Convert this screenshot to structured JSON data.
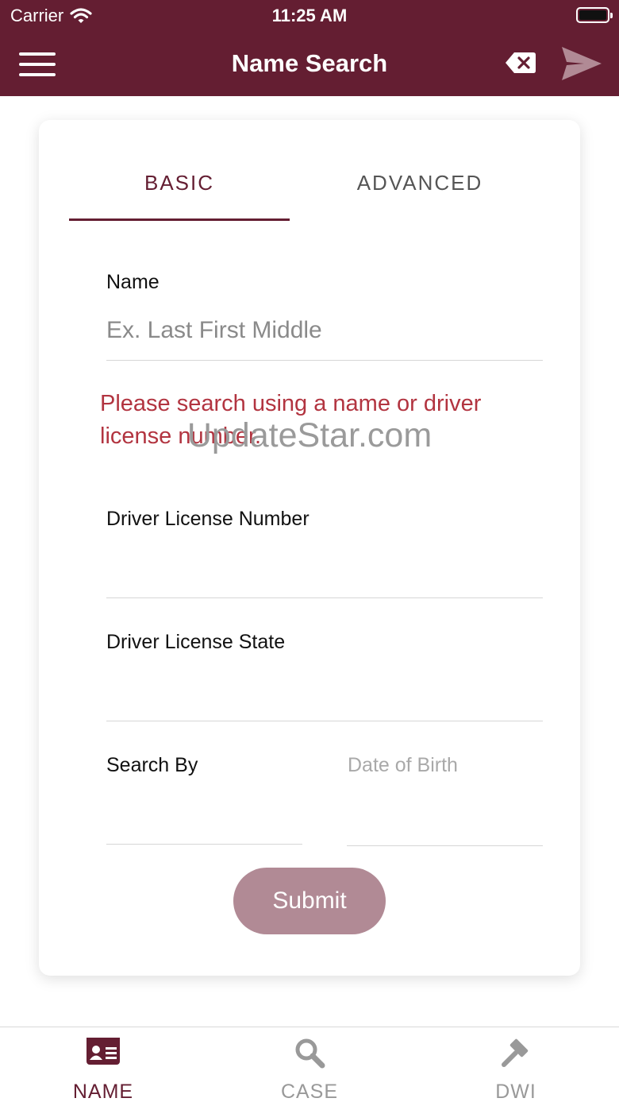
{
  "status_bar": {
    "carrier": "Carrier",
    "time": "11:25 AM"
  },
  "nav": {
    "title": "Name Search",
    "menu_icon": "hamburger-icon",
    "clear_icon": "backspace-icon",
    "send_icon": "send-icon"
  },
  "tabs": [
    {
      "label": "BASIC",
      "selected": true
    },
    {
      "label": "ADVANCED",
      "selected": false
    }
  ],
  "form": {
    "name_label": "Name",
    "name_placeholder": "Ex. Last First Middle",
    "error_message": "Please search using a name or driver license number.",
    "dl_number_label": "Driver License Number",
    "dl_state_label": "Driver License State",
    "search_by_label": "Search By",
    "search_by_value": "Date of Birth",
    "submit_label": "Submit"
  },
  "watermark": "UpdateStar.com",
  "tabbar": [
    {
      "label": "NAME",
      "icon": "id-card-icon",
      "active": true
    },
    {
      "label": "CASE",
      "icon": "search-icon",
      "active": false
    },
    {
      "label": "DWI",
      "icon": "gavel-icon",
      "active": false
    }
  ],
  "colors": {
    "brand": "#641e32",
    "error": "#b23440",
    "submit_disabled": "#b18a95",
    "inactive": "#999999"
  }
}
